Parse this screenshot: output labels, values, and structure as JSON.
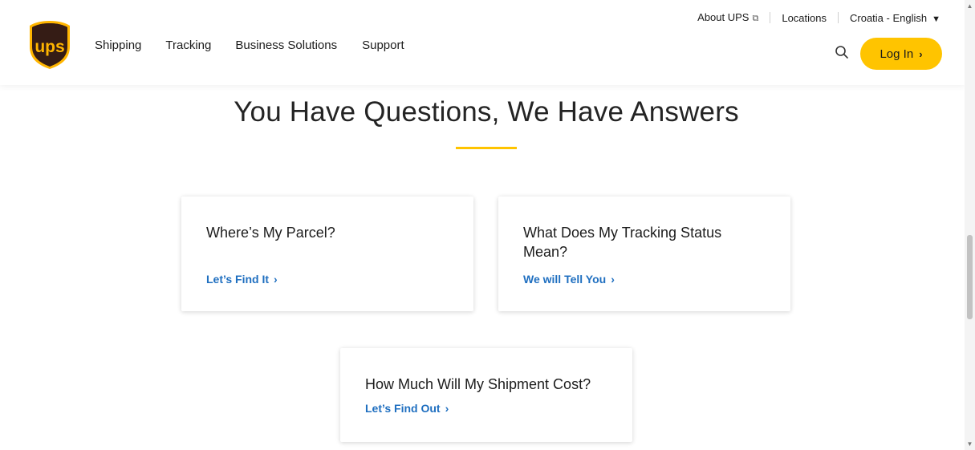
{
  "brand": {
    "logo_text": "ups",
    "brown": "#351c15",
    "gold": "#ffb500"
  },
  "nav": {
    "items": [
      "Shipping",
      "Tracking",
      "Business Solutions",
      "Support"
    ]
  },
  "utility": {
    "about": "About UPS",
    "about_icon": "external-link-icon",
    "locations": "Locations",
    "locale": "Croatia - English",
    "locale_icon": "chevron-down-icon"
  },
  "header_actions": {
    "search_icon": "search-icon",
    "login_label": "Log In",
    "login_color": "#ffc400"
  },
  "main": {
    "title": "You Have Questions, We Have Answers",
    "cards": [
      {
        "question": "Where’s My Parcel?",
        "link": "Let’s Find It"
      },
      {
        "question": "What Does My Tracking Status Mean?",
        "link": "We will Tell You"
      },
      {
        "question": "How Much Will My Shipment Cost?",
        "link": "Let’s Find Out"
      }
    ],
    "link_color": "#1f6fc0",
    "accent": "#ffc400"
  }
}
